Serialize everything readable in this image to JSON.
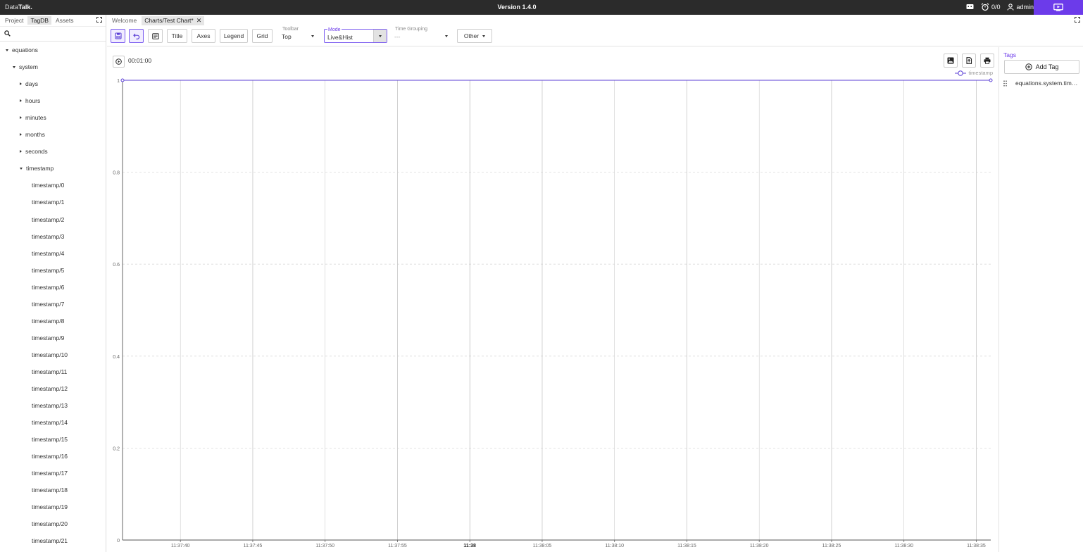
{
  "app": {
    "brand_prefix": "Data",
    "brand_suffix": "Talk.",
    "version": "Version 1.4.0",
    "alarm_count": "0/0",
    "user": "admin"
  },
  "left_panel": {
    "tabs": [
      "Project",
      "TagDB",
      "Assets"
    ],
    "active_tab": "TagDB",
    "search_placeholder": "",
    "tree": [
      {
        "label": "equations",
        "depth": 0,
        "caret": "down"
      },
      {
        "label": "system",
        "depth": 1,
        "caret": "down"
      },
      {
        "label": "days",
        "depth": 2,
        "caret": "right"
      },
      {
        "label": "hours",
        "depth": 2,
        "caret": "right"
      },
      {
        "label": "minutes",
        "depth": 2,
        "caret": "right"
      },
      {
        "label": "months",
        "depth": 2,
        "caret": "right"
      },
      {
        "label": "seconds",
        "depth": 2,
        "caret": "right"
      },
      {
        "label": "timestamp",
        "depth": 2,
        "caret": "down"
      },
      {
        "label": "timestamp/0",
        "depth": 3,
        "caret": "none"
      },
      {
        "label": "timestamp/1",
        "depth": 3,
        "caret": "none"
      },
      {
        "label": "timestamp/2",
        "depth": 3,
        "caret": "none"
      },
      {
        "label": "timestamp/3",
        "depth": 3,
        "caret": "none"
      },
      {
        "label": "timestamp/4",
        "depth": 3,
        "caret": "none"
      },
      {
        "label": "timestamp/5",
        "depth": 3,
        "caret": "none"
      },
      {
        "label": "timestamp/6",
        "depth": 3,
        "caret": "none"
      },
      {
        "label": "timestamp/7",
        "depth": 3,
        "caret": "none"
      },
      {
        "label": "timestamp/8",
        "depth": 3,
        "caret": "none"
      },
      {
        "label": "timestamp/9",
        "depth": 3,
        "caret": "none"
      },
      {
        "label": "timestamp/10",
        "depth": 3,
        "caret": "none"
      },
      {
        "label": "timestamp/11",
        "depth": 3,
        "caret": "none"
      },
      {
        "label": "timestamp/12",
        "depth": 3,
        "caret": "none"
      },
      {
        "label": "timestamp/13",
        "depth": 3,
        "caret": "none"
      },
      {
        "label": "timestamp/14",
        "depth": 3,
        "caret": "none"
      },
      {
        "label": "timestamp/15",
        "depth": 3,
        "caret": "none"
      },
      {
        "label": "timestamp/16",
        "depth": 3,
        "caret": "none"
      },
      {
        "label": "timestamp/17",
        "depth": 3,
        "caret": "none"
      },
      {
        "label": "timestamp/18",
        "depth": 3,
        "caret": "none"
      },
      {
        "label": "timestamp/19",
        "depth": 3,
        "caret": "none"
      },
      {
        "label": "timestamp/20",
        "depth": 3,
        "caret": "none"
      },
      {
        "label": "timestamp/21",
        "depth": 3,
        "caret": "none"
      }
    ]
  },
  "doc_tabs": [
    {
      "label": "Welcome",
      "active": false
    },
    {
      "label": "Charts/Test Chart*",
      "active": true
    }
  ],
  "toolbar": {
    "title_label": "Title",
    "axes_label": "Axes",
    "legend_label": "Legend",
    "grid_label": "Grid",
    "toolbar_select": {
      "label": "Toolbar",
      "value": "Top"
    },
    "mode_select": {
      "label": "Mode",
      "value": "Live&Hist"
    },
    "time_grouping_select": {
      "label": "Time Grouping",
      "value": "---"
    },
    "other_label": "Other"
  },
  "chart": {
    "duration": "00:01:00"
  },
  "chart_data": {
    "type": "line",
    "series": [
      {
        "name": "timestamp",
        "x": [
          "11:37:36",
          "11:38:36"
        ],
        "y": [
          1,
          1
        ]
      }
    ],
    "x_ticks": [
      "11:37:40",
      "11:37:45",
      "11:37:50",
      "11:37:55",
      "11:38",
      "11:38:05",
      "11:38:10",
      "11:38:15",
      "11:38:20",
      "11:38:25",
      "11:38:30",
      "11:38:35"
    ],
    "y_ticks": [
      "0",
      "0.2",
      "0.4",
      "0.6",
      "0.8",
      "1"
    ],
    "ylim": [
      0,
      1
    ],
    "grid": true,
    "legend_position": "top-right",
    "series_color": "#5b3fd6"
  },
  "right_panel": {
    "title": "Tags",
    "add_tag_label": "Add Tag",
    "tags": [
      "equations.system.timestamp"
    ]
  }
}
